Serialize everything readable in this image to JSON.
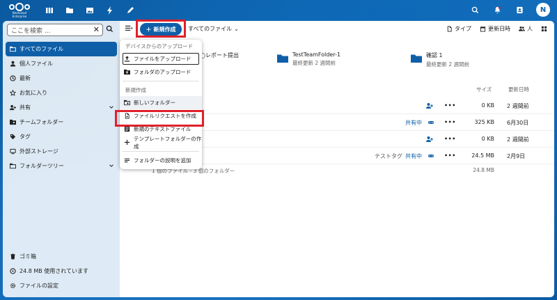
{
  "logo": {
    "line1": "Nextcloud",
    "line2": "Enterprise"
  },
  "topbar": {
    "apps": [
      "dashboard-icon",
      "files-icon",
      "photos-icon",
      "activity-icon",
      "notes-icon"
    ],
    "avatar_initial": "N"
  },
  "sidebar": {
    "search_placeholder": "ここを検索 ...",
    "items": [
      {
        "label": "すべてのファイル",
        "icon": "folder-icon",
        "active": true
      },
      {
        "label": "個人ファイル",
        "icon": "person-icon"
      },
      {
        "label": "最新",
        "icon": "clock-icon"
      },
      {
        "label": "お気に入り",
        "icon": "star-icon"
      },
      {
        "label": "共有",
        "icon": "share-icon",
        "expandable": true
      },
      {
        "label": "チームフォルダー",
        "icon": "team-folder-icon"
      },
      {
        "label": "タグ",
        "icon": "tag-icon"
      },
      {
        "label": "外部ストレージ",
        "icon": "external-storage-icon"
      },
      {
        "label": "フォルダーツリー",
        "icon": "folder-tree-icon",
        "expandable": true
      }
    ],
    "bottom": [
      {
        "label": "ゴミ箱",
        "icon": "trash-icon"
      },
      {
        "label": "24.8 MB 使用されています",
        "icon": "storage-icon"
      },
      {
        "label": "ファイルの設定",
        "icon": "gear-icon"
      }
    ]
  },
  "main": {
    "new_button": "新規作成",
    "breadcrumb": "すべてのファイル",
    "view": {
      "type": "タイプ",
      "modified": "更新日時",
      "people": "人"
    },
    "cards": [
      {
        "title": "◯レポート提出",
        "subtitle": ""
      },
      {
        "title": "TestTeamFolder-1",
        "subtitle": "最終更新 2 週間前"
      },
      {
        "title": "確認 1",
        "subtitle": "最終更新 2 週間前"
      }
    ],
    "columns": {
      "size": "サイズ",
      "modified": "更新日時"
    },
    "rows": [
      {
        "tag": "",
        "shared": "",
        "size": "0 KB",
        "modified": "2 週間前",
        "action": "add-share"
      },
      {
        "tag": "",
        "shared": "共有中",
        "size": "325 KB",
        "modified": "6月30日",
        "action": "link"
      },
      {
        "tag": "",
        "shared": "",
        "size": "0 KB",
        "modified": "2 週間前",
        "action": "add-share"
      },
      {
        "tag": "テストタグ",
        "shared": "共有中",
        "size": "24.5 MB",
        "modified": "2月9日",
        "action": "link"
      }
    ],
    "summary": {
      "count": "1 個のファイル - 3 個のフォルダー",
      "total": "24.8 MB"
    }
  },
  "dropdown": {
    "upload_header": "デバイスからのアップロード",
    "upload_file": "ファイルをアップロード",
    "upload_folder": "フォルダのアップロード",
    "new_header": "新規作成",
    "new_folder": "新しいフォルダー",
    "file_request": "ファイルリクエストを作成",
    "new_text": "新規のテキストファイル",
    "template_folder": "テンプレートフォルダーの作成",
    "folder_description": "フォルダーの説明を追加"
  },
  "colors": {
    "primary": "#0f5fa8",
    "highlight": "#e0202a"
  }
}
